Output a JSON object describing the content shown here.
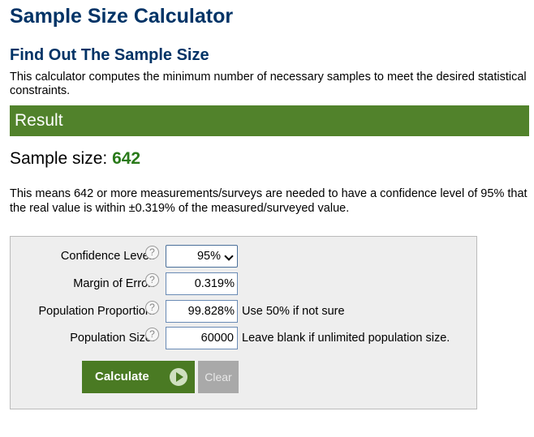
{
  "page": {
    "title": "Sample Size Calculator",
    "section_title": "Find Out The Sample Size",
    "intro": "This calculator computes the minimum number of necessary samples to meet the desired statistical constraints."
  },
  "result": {
    "header": "Result",
    "sample_label": "Sample size: ",
    "sample_value": "642",
    "explanation": "This means 642 or more measurements/surveys are needed to have a confidence level of 95% that the real value is within ±0.319% of the measured/surveyed value."
  },
  "form": {
    "confidence": {
      "label": "Confidence Level:",
      "value": "95%"
    },
    "margin": {
      "label": "Margin of Error:",
      "value": "0.319",
      "unit": "%"
    },
    "proportion": {
      "label": "Population Proportion:",
      "value": "99.828",
      "unit": "%",
      "hint": "Use 50% if not sure"
    },
    "population": {
      "label": "Population Size:",
      "value": "60000",
      "hint": "Leave blank if unlimited population size."
    },
    "help_glyph": "?",
    "calculate_label": "Calculate",
    "clear_label": "Clear"
  },
  "colors": {
    "title": "#003366",
    "result_bar": "#51822b",
    "sample_value": "#2a7a1a",
    "calc_button": "#4a7a23",
    "clear_button": "#a9a9a9"
  },
  "icons": [
    "help-icon",
    "chevron-down-icon",
    "play-icon"
  ]
}
